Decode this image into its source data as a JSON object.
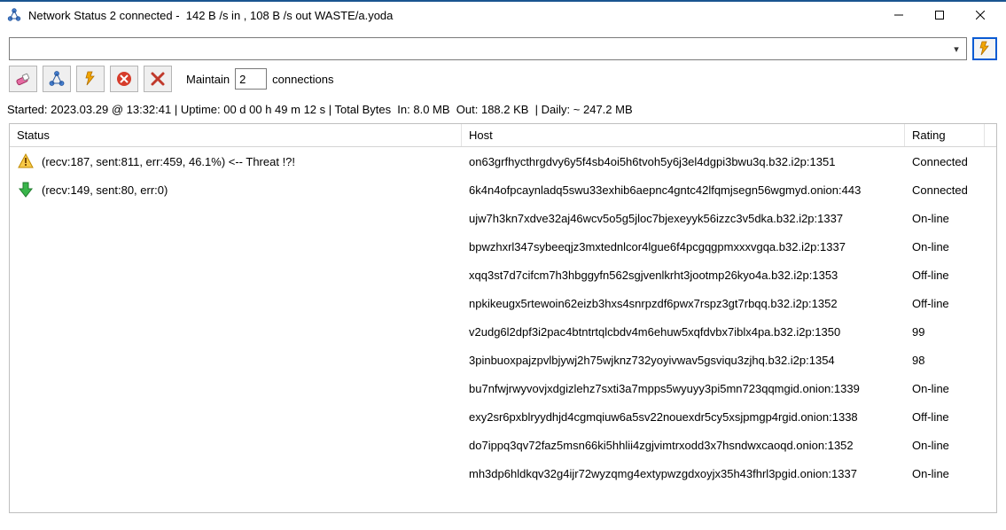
{
  "window": {
    "title": "Network Status 2 connected -  142 B /s in , 108 B /s out WASTE/a.yoda"
  },
  "toolbar": {
    "maintain_label": "Maintain",
    "maintain_value": "2",
    "connections_label": "connections"
  },
  "address": {
    "value": ""
  },
  "stats_line": "Started: 2023.03.29 @ 13:32:41 | Uptime: 00 d 00 h 49 m 12 s | Total Bytes  In: 8.0 MB  Out: 188.2 KB  | Daily: ~ 247.2 MB",
  "grid": {
    "columns": {
      "status": "Status",
      "host": "Host",
      "rating": "Rating"
    },
    "rows": [
      {
        "icon": "warn",
        "status": "(recv:187, sent:811, err:459, 46.1%) <-- Threat !?!",
        "host": "on63grfhycthrgdvy6y5f4sb4oi5h6tvoh5y6j3el4dgpi3bwu3q.b32.i2p:1351",
        "rating": "Connected"
      },
      {
        "icon": "down",
        "status": "(recv:149, sent:80, err:0)",
        "host": "6k4n4ofpcaynladq5swu33exhib6aepnc4gntc42lfqmjsegn56wgmyd.onion:443",
        "rating": "Connected"
      },
      {
        "icon": "",
        "status": "",
        "host": "ujw7h3kn7xdve32aj46wcv5o5g5jloc7bjexeyyk56izzc3v5dka.b32.i2p:1337",
        "rating": "On-line"
      },
      {
        "icon": "",
        "status": "",
        "host": "bpwzhxrl347sybeeqjz3mxtednlcor4lgue6f4pcgqgpmxxxvgqa.b32.i2p:1337",
        "rating": "On-line"
      },
      {
        "icon": "",
        "status": "",
        "host": "xqq3st7d7cifcm7h3hbggyfn562sgjvenlkrht3jootmp26kyo4a.b32.i2p:1353",
        "rating": "Off-line"
      },
      {
        "icon": "",
        "status": "",
        "host": "npkikeugx5rtewoin62eizb3hxs4snrpzdf6pwx7rspz3gt7rbqq.b32.i2p:1352",
        "rating": "Off-line"
      },
      {
        "icon": "",
        "status": "",
        "host": "v2udg6l2dpf3i2pac4btntrtqlcbdv4m6ehuw5xqfdvbx7iblx4pa.b32.i2p:1350",
        "rating": "99"
      },
      {
        "icon": "",
        "status": "",
        "host": "3pinbuoxpajzpvlbjywj2h75wjknz732yoyivwav5gsviqu3zjhq.b32.i2p:1354",
        "rating": "98"
      },
      {
        "icon": "",
        "status": "",
        "host": "bu7nfwjrwyvovjxdgizlehz7sxti3a7mpps5wyuyy3pi5mn723qqmgid.onion:1339",
        "rating": "On-line"
      },
      {
        "icon": "",
        "status": "",
        "host": "exy2sr6pxblryydhjd4cgmqiuw6a5sv22nouexdr5cy5xsjpmgp4rgid.onion:1338",
        "rating": "Off-line"
      },
      {
        "icon": "",
        "status": "",
        "host": "do7ippq3qv72faz5msn66ki5hhlii4zgjvimtrxodd3x7hsndwxcaoqd.onion:1352",
        "rating": "On-line"
      },
      {
        "icon": "",
        "status": "",
        "host": "mh3dp6hldkqv32g4ijr72wyzqmg4extypwzgdxoyjx35h43fhrl3pgid.onion:1337",
        "rating": "On-line"
      }
    ]
  }
}
